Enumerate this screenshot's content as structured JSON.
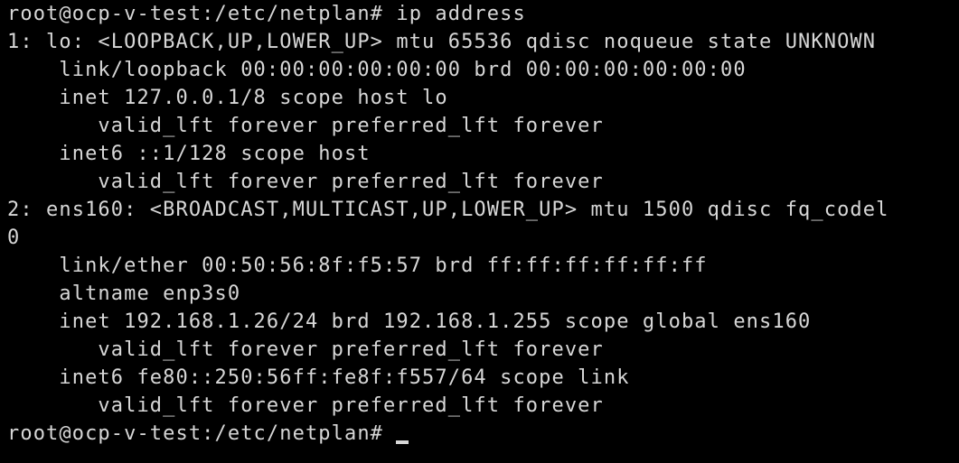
{
  "terminal": {
    "lines": [
      "root@ocp-v-test:/etc/netplan# ip address",
      "1: lo: <LOOPBACK,UP,LOWER_UP> mtu 65536 qdisc noqueue state UNKNOWN",
      "    link/loopback 00:00:00:00:00:00 brd 00:00:00:00:00:00",
      "    inet 127.0.0.1/8 scope host lo",
      "       valid_lft forever preferred_lft forever",
      "    inet6 ::1/128 scope host",
      "       valid_lft forever preferred_lft forever",
      "2: ens160: <BROADCAST,MULTICAST,UP,LOWER_UP> mtu 1500 qdisc fq_codel",
      "0",
      "    link/ether 00:50:56:8f:f5:57 brd ff:ff:ff:ff:ff:ff",
      "    altname enp3s0",
      "    inet 192.168.1.26/24 brd 192.168.1.255 scope global ens160",
      "       valid_lft forever preferred_lft forever",
      "    inet6 fe80::250:56ff:fe8f:f557/64 scope link",
      "       valid_lft forever preferred_lft forever"
    ],
    "prompt": "root@ocp-v-test:/etc/netplan# "
  }
}
